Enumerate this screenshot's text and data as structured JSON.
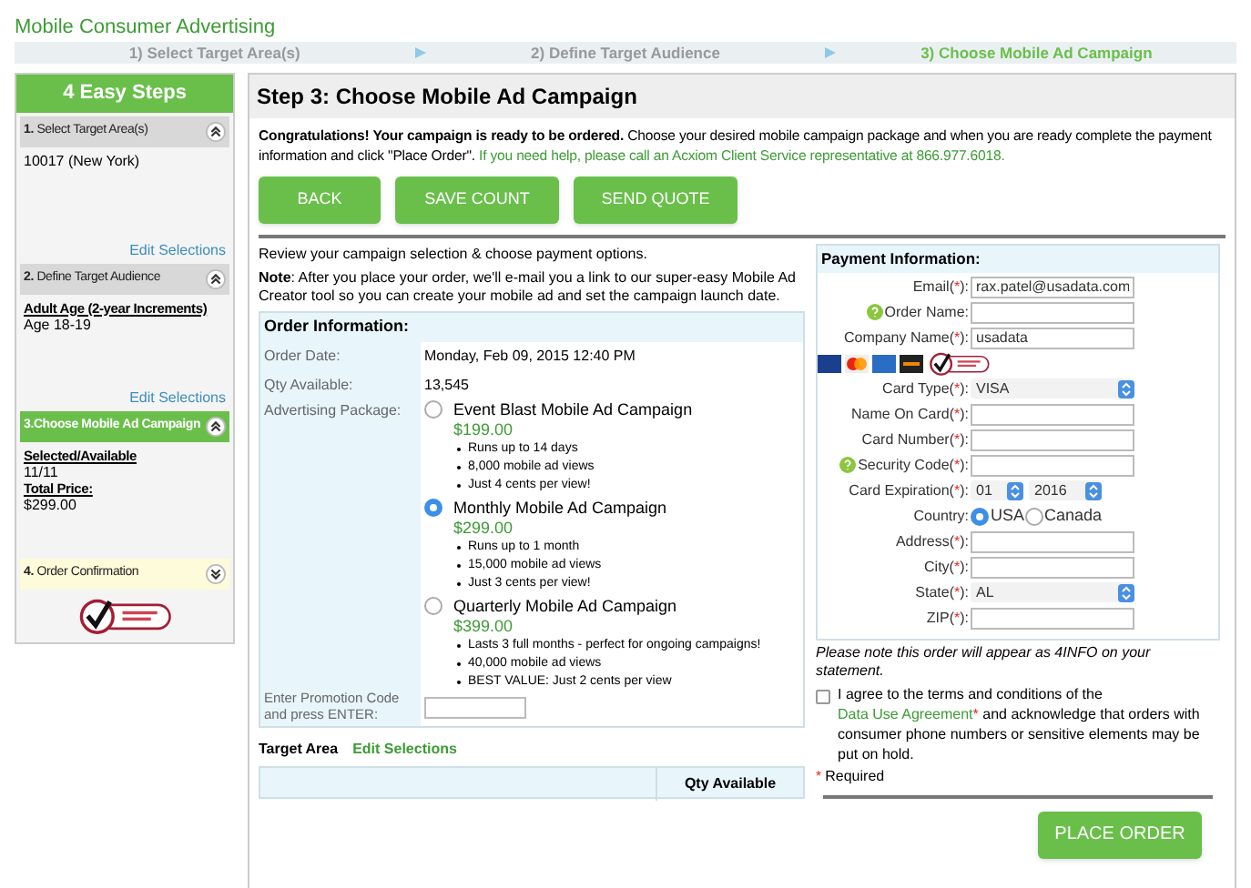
{
  "app_title": "Mobile Consumer Advertising",
  "steps": [
    {
      "label": "1) Select Target Area(s)",
      "selected": false
    },
    {
      "label": "2) Define Target Audience",
      "selected": false
    },
    {
      "label": "3) Choose Mobile Ad Campaign",
      "selected": true
    }
  ],
  "sidebar": {
    "title": "4 Easy Steps",
    "sections": [
      {
        "title": "**1.** Select Target Area(s)",
        "kind": "done",
        "expanded": true,
        "lines": [
          {
            "kind": "value",
            "text": "10017 (New York)"
          }
        ],
        "link": "Edit Selections"
      },
      {
        "title": "**2.** Define Target Audience",
        "kind": "done",
        "expanded": true,
        "lines": [
          {
            "kind": "heading",
            "text": "Adult Age (2-year Increments)"
          },
          {
            "kind": "value",
            "text": "Age 18-19"
          }
        ],
        "link": "Edit Selections"
      },
      {
        "title": "3.Choose Mobile Ad Campaign",
        "kind": "active",
        "expanded": true,
        "lines": [
          {
            "kind": "heading",
            "text": "Selected/Available"
          },
          {
            "kind": "value",
            "text": "11/11"
          },
          {
            "kind": "heading",
            "text": "Total Price:"
          },
          {
            "kind": "value",
            "text": "$299.00"
          }
        ]
      },
      {
        "title": "**4.** Order Confirmation",
        "kind": "pending",
        "expanded": false
      }
    ]
  },
  "main": {
    "title": "Step 3: Choose Mobile Ad Campaign",
    "intro": {
      "lead": "Congratulations! Your campaign is ready to be ordered.",
      "body": "Choose your desired mobile campaign package and when you are ready complete the payment information and click \"Place Order\".",
      "help": "If you need help, please call an Acxiom Client Service representative at 866.977.6018."
    },
    "buttons": [
      "BACK",
      "SAVE COUNT",
      "SEND QUOTE"
    ],
    "review_text": "Review your campaign selection & choose payment options.",
    "note": "**Note**: After you place your order, we'll e-mail you a link to our super-easy Mobile Ad Creator tool so you can create your mobile ad and set the campaign launch date.",
    "order_info": {
      "title": "Order Information:",
      "rows": [
        {
          "label": "Order Date:",
          "value": "Monday, Feb 09, 2015 12:40 PM"
        },
        {
          "label": "Qty Available:",
          "value": "13,545"
        }
      ],
      "package_label": "Advertising Package:",
      "packages": [
        {
          "name": "Event Blast Mobile Ad Campaign",
          "price": "$199.00",
          "selected": false,
          "bullets": [
            "Runs up to 14 days",
            "8,000 mobile ad views",
            "Just 4 cents per view!"
          ]
        },
        {
          "name": "Monthly Mobile Ad Campaign",
          "price": "$299.00",
          "selected": true,
          "bullets": [
            "Runs up to 1 month",
            "15,000 mobile ad views",
            "Just 3 cents per view!"
          ]
        },
        {
          "name": "Quarterly Mobile Ad Campaign",
          "price": "$399.00",
          "selected": false,
          "bullets": [
            "Lasts 3 full months - perfect for ongoing campaigns!",
            "40,000 mobile ad views",
            "BEST VALUE: Just 2 cents per view"
          ]
        }
      ],
      "promo_label": "Enter Promotion Code and press ENTER:"
    },
    "target_area": {
      "title": "Target Area",
      "link": "Edit Selections",
      "columns": [
        "Qty Available"
      ]
    }
  },
  "payment": {
    "title": "Payment Information:",
    "fields": [
      {
        "kind": "text",
        "label": "Email(",
        "mark": "*",
        "end": "):",
        "value": "rax.patel@usadata.com"
      },
      {
        "kind": "text",
        "label": "Order Name:",
        "help": true
      },
      {
        "kind": "text",
        "label": "Company Name(",
        "mark": "*",
        "end": "):",
        "value": "usadata"
      },
      {
        "kind": "cards"
      },
      {
        "kind": "select",
        "label": "Card Type(",
        "mark": "*",
        "end": "):",
        "value": "VISA"
      },
      {
        "kind": "text",
        "label": "Name On Card(",
        "mark": "*",
        "end": "):"
      },
      {
        "kind": "text",
        "label": "Card Number(",
        "mark": "*",
        "end": "):"
      },
      {
        "kind": "text",
        "label": "Security Code(",
        "mark": "*",
        "end": "):",
        "help": true
      },
      {
        "kind": "selects",
        "label": "Card Expiration(",
        "mark": "*",
        "end": "):",
        "values": [
          "01",
          "2016"
        ]
      },
      {
        "kind": "radio",
        "label": "Country:",
        "options": [
          {
            "label": "USA",
            "selected": true
          },
          {
            "label": "Canada",
            "selected": false
          }
        ]
      },
      {
        "kind": "text",
        "label": "Address(",
        "mark": "*",
        "end": "):"
      },
      {
        "kind": "text",
        "label": "City(",
        "mark": "*",
        "end": "):"
      },
      {
        "kind": "select",
        "label": "State(",
        "mark": "*",
        "end": "):",
        "value": "AL"
      },
      {
        "kind": "text",
        "label": "ZIP(",
        "mark": "*",
        "end": "):"
      }
    ],
    "statement_note": "Please note this order will appear as 4INFO on your statement.",
    "agreement": {
      "checked": false,
      "before": "I agree to the terms and conditions of the",
      "link": "Data Use Agreement",
      "mark": "*",
      "after": "and acknowledge that orders with consumer phone numbers or sensitive elements may be put on hold."
    },
    "required_note": {
      "mark": "*",
      "text": "Required"
    },
    "submit": "PLACE ORDER"
  }
}
